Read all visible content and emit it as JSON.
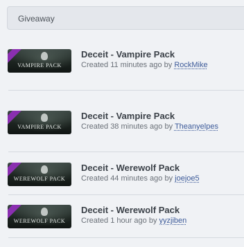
{
  "header": {
    "label": "Giveaway"
  },
  "rows": [
    {
      "title": "Deceit - Vampire Pack",
      "created": "Created 11 minutes ago by",
      "user": "RockMike",
      "thumb_text": "VAMPIRE PACK"
    },
    {
      "title": "Deceit - Vampire Pack",
      "created": "Created 38 minutes ago by",
      "user": "Theanyelpes",
      "thumb_text": "VAMPIRE PACK"
    },
    {
      "title": "Deceit - Werewolf Pack",
      "created": "Created 44 minutes ago by",
      "user": "joejoe5",
      "thumb_text": "WEREWOLF PACK"
    },
    {
      "title": "Deceit - Werewolf Pack",
      "created": "Created 1 hour ago by",
      "user": "yyzjiben",
      "thumb_text": "WEREWOLF PACK"
    }
  ],
  "colors": {
    "ribbon": "#8a2fb0",
    "link": "#3c5a99",
    "title": "#3b4148"
  },
  "icons": {
    "thumb_badge": "dlc-ribbon-icon"
  }
}
